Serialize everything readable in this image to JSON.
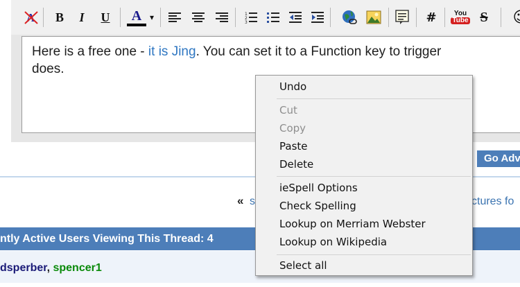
{
  "toolbar": {
    "buttons": [
      {
        "name": "remove-format-icon",
        "glyph": ""
      },
      {
        "name": "bold-button",
        "glyph": "B"
      },
      {
        "name": "italic-button",
        "glyph": "I"
      },
      {
        "name": "underline-button",
        "glyph": "U"
      },
      {
        "name": "font-color-button",
        "glyph": "A"
      },
      {
        "name": "font-color-dropdown",
        "glyph": "▾"
      },
      {
        "name": "align-left-button",
        "glyph": ""
      },
      {
        "name": "align-center-button",
        "glyph": ""
      },
      {
        "name": "align-right-button",
        "glyph": ""
      },
      {
        "name": "ordered-list-button",
        "glyph": ""
      },
      {
        "name": "unordered-list-button",
        "glyph": ""
      },
      {
        "name": "outdent-button",
        "glyph": ""
      },
      {
        "name": "indent-button",
        "glyph": ""
      },
      {
        "name": "insert-link-button",
        "glyph": ""
      },
      {
        "name": "insert-image-button",
        "glyph": ""
      },
      {
        "name": "quote-button",
        "glyph": ""
      },
      {
        "name": "hash-button",
        "glyph": "#"
      },
      {
        "name": "youtube-button",
        "glyph": ""
      },
      {
        "name": "strikethrough-button",
        "glyph": "S"
      },
      {
        "name": "smiley-button",
        "glyph": "☺"
      }
    ],
    "font_color_hex": "#1a1a8c",
    "youtube_you": "You",
    "youtube_tube": "Tube"
  },
  "editor": {
    "line1_prefix": "Here is a free one - ",
    "line1_link": "it is Jing",
    "line1_suffix": ". You can set it to a Function key to trigger",
    "line2": "does."
  },
  "go_button": {
    "label": "Go Advanced"
  },
  "pager": {
    "arrow": "«",
    "left_fragment": "s",
    "right_fragment": "ctures fo"
  },
  "active_users": {
    "title": "ntly Active Users Viewing This Thread: 4",
    "user1": "dsperber",
    "separator": ", ",
    "user2": "spencer1"
  },
  "context_menu": {
    "undo": "Undo",
    "cut": "Cut",
    "copy": "Copy",
    "paste": "Paste",
    "delete": "Delete",
    "iespell": "ieSpell Options",
    "check_spelling": "Check Spelling",
    "lookup_merriam": "Lookup on Merriam Webster",
    "lookup_wikipedia": "Lookup on Wikipedia",
    "select_all": "Select all"
  },
  "colors": {
    "accent_blue": "#4d7eb9",
    "link_blue": "#2f77c2",
    "user_green": "#0a8a0a"
  }
}
